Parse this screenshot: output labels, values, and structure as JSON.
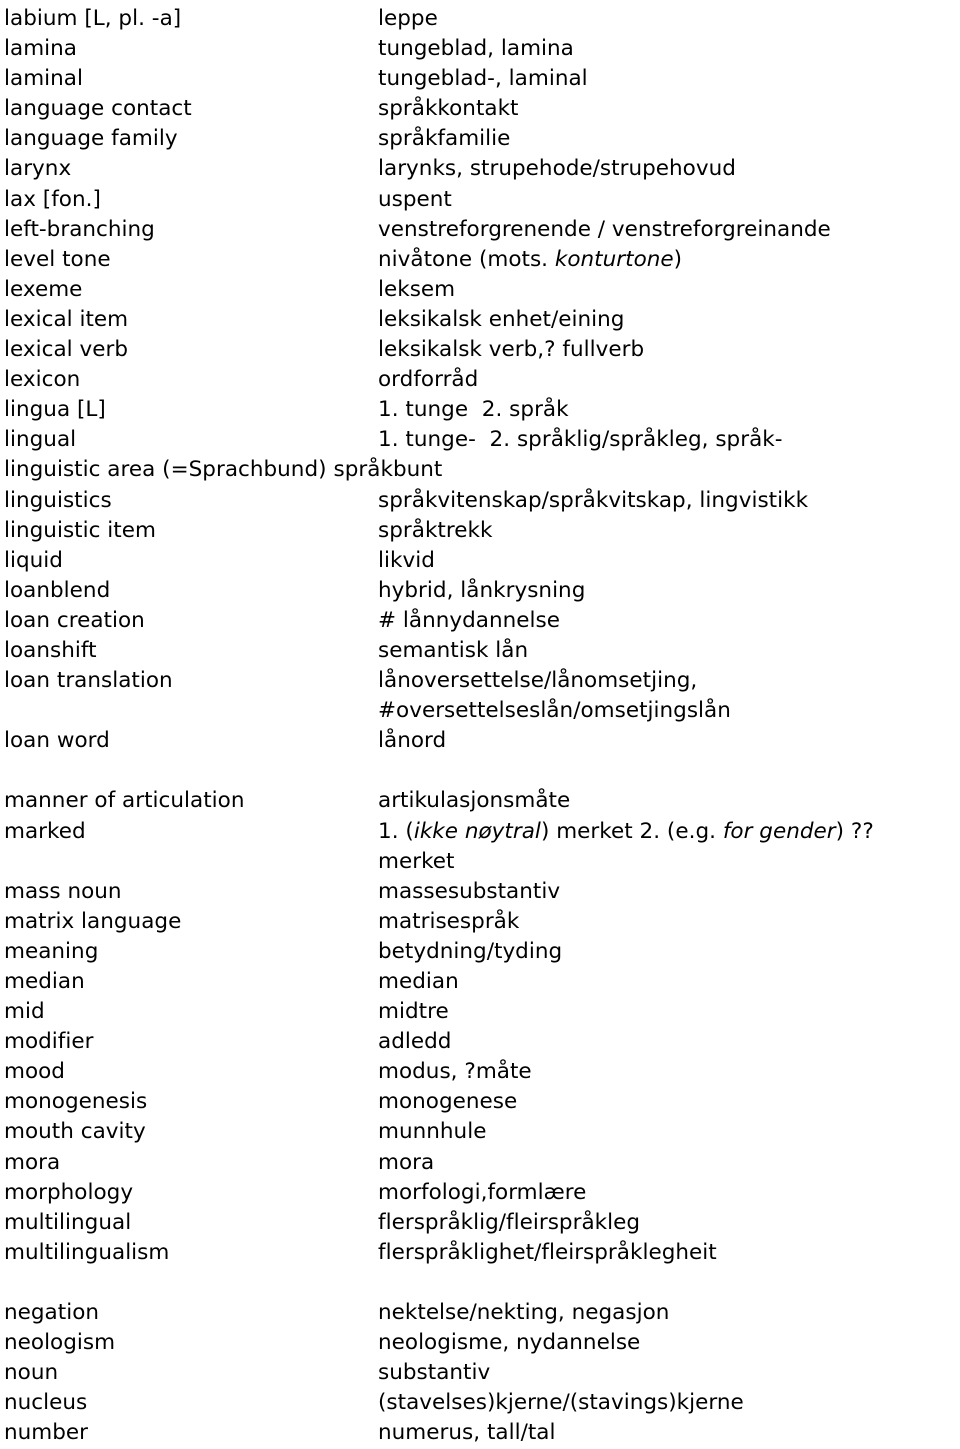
{
  "document": {
    "type": "bilingual-glossary",
    "source_language": "English",
    "target_language": "Norwegian",
    "letters_covered": [
      "L",
      "M",
      "N"
    ]
  },
  "entries": [
    {
      "term": "labium [L, pl. -a]",
      "gloss": "leppe"
    },
    {
      "term": "lamina",
      "gloss": "tungeblad, lamina"
    },
    {
      "term": "laminal",
      "gloss": "tungeblad-, laminal"
    },
    {
      "term": "language contact",
      "gloss": "språkkontakt"
    },
    {
      "term": "language family",
      "gloss": "språkfamilie"
    },
    {
      "term": "larynx",
      "gloss": "larynks, strupehode/strupehovud"
    },
    {
      "term": "lax [fon.]",
      "gloss": "uspent"
    },
    {
      "term": "left-branching",
      "gloss": "venstreforgrenende / venstreforgreinande"
    },
    {
      "term": "level tone",
      "gloss_parts": [
        {
          "text": "nivåtone (mots. ",
          "italic": false
        },
        {
          "text": "konturtone",
          "italic": true
        },
        {
          "text": ")",
          "italic": false
        }
      ],
      "gloss": "nivåtone (mots. konturtone)"
    },
    {
      "term": "lexeme",
      "gloss": "leksem"
    },
    {
      "term": "lexical item",
      "gloss": "leksikalsk enhet/eining"
    },
    {
      "term": "lexical verb",
      "gloss": "leksikalsk verb,? fullverb"
    },
    {
      "term": "lexicon",
      "gloss": "ordforråd"
    },
    {
      "term": "lingua [L]",
      "gloss": "1. tunge  2. språk"
    },
    {
      "term": "lingual",
      "gloss": "1. tunge-  2. språklig/språkleg, språk-"
    },
    {
      "term": "linguistic area (=Sprachbund)",
      "gloss": "språkbunt",
      "wide": true
    },
    {
      "term": "linguistics",
      "gloss": "språkvitenskap/språkvitskap, lingvistikk"
    },
    {
      "term": "linguistic item",
      "gloss": "språktrekk"
    },
    {
      "term": "liquid",
      "gloss": "likvid"
    },
    {
      "term": "loanblend",
      "gloss": "hybrid, lånkrysning"
    },
    {
      "term": "loan creation",
      "gloss": "# lånnydannelse"
    },
    {
      "term": "loanshift",
      "gloss": "semantisk lån"
    },
    {
      "term": "loan translation",
      "gloss": "lånoversettelse/lånomsetjing,"
    },
    {
      "term": "",
      "gloss": "#oversettelseslån/omsetjingslån",
      "continuation": true
    },
    {
      "term": "loan word",
      "gloss": "lånord"
    },
    {
      "spacer": true
    },
    {
      "term": "manner of articulation",
      "gloss": "artikulasjonsmåte"
    },
    {
      "term": "marked",
      "gloss_parts": [
        {
          "text": "1. (",
          "italic": false
        },
        {
          "text": "ikke nøytral",
          "italic": true
        },
        {
          "text": ") merket 2. (e.g. ",
          "italic": false
        },
        {
          "text": "for gender",
          "italic": true
        },
        {
          "text": ") ??",
          "italic": false
        }
      ],
      "gloss": "1. (ikke nøytral) merket 2. (e.g. for gender) ??"
    },
    {
      "term": "",
      "gloss": "merket",
      "continuation": true
    },
    {
      "term": "mass noun",
      "gloss": "massesubstantiv"
    },
    {
      "term": "matrix language",
      "gloss": "matrisespråk"
    },
    {
      "term": "meaning",
      "gloss": "betydning/tyding"
    },
    {
      "term": "median",
      "gloss": "median"
    },
    {
      "term": "mid",
      "gloss": "midtre"
    },
    {
      "term": "modifier",
      "gloss": "adledd"
    },
    {
      "term": "mood",
      "gloss": "modus, ?måte"
    },
    {
      "term": "monogenesis",
      "gloss": "monogenese"
    },
    {
      "term": "mouth cavity",
      "gloss": "munnhule"
    },
    {
      "term": "mora",
      "gloss": "mora"
    },
    {
      "term": "morphology",
      "gloss": "morfologi,formlære"
    },
    {
      "term": "multilingual",
      "gloss": "flerspråklig/fleirspråkleg"
    },
    {
      "term": "multilingualism",
      "gloss": "flerspråklighet/fleirspråklegheit"
    },
    {
      "spacer": true
    },
    {
      "term": "negation",
      "gloss": "nektelse/nekting, negasjon"
    },
    {
      "term": "neologism",
      "gloss": "neologisme, nydannelse"
    },
    {
      "term": "noun",
      "gloss": "substantiv"
    },
    {
      "term": "nucleus",
      "gloss": "(stavelses)kjerne/(stavings)kjerne"
    },
    {
      "term": "number",
      "gloss": "numerus, tall/tal"
    }
  ]
}
